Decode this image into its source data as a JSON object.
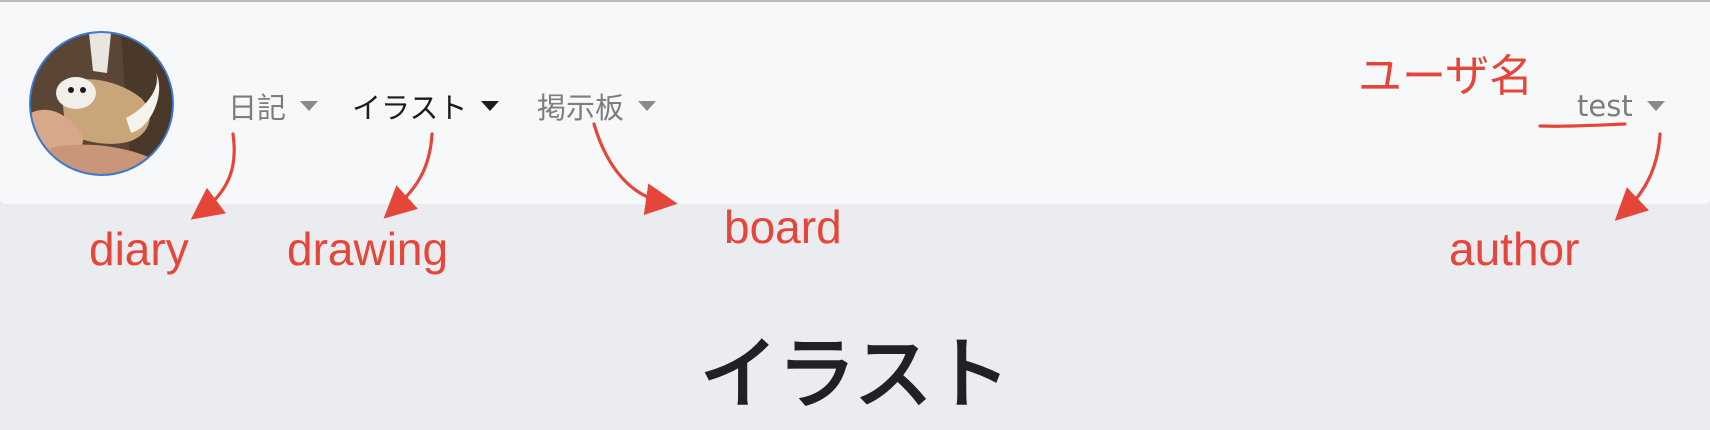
{
  "nav": {
    "items": [
      {
        "label": "日記",
        "active": false
      },
      {
        "label": "イラスト",
        "active": true
      },
      {
        "label": "掲示板",
        "active": false
      }
    ],
    "user": {
      "label": "test"
    }
  },
  "annotations": {
    "diary": "diary",
    "drawing": "drawing",
    "board": "board",
    "author": "author",
    "username": "ユーザ名"
  },
  "page": {
    "heading": "イラスト"
  },
  "colors": {
    "annotation": "#e5463a",
    "avatar_border": "#3a7bd5",
    "navbar_bg": "#f7f8fa",
    "page_bg": "#ebecef"
  },
  "icons": [
    "avatar-ferret-photo",
    "caret-down-icon",
    "annotation-arrow"
  ]
}
